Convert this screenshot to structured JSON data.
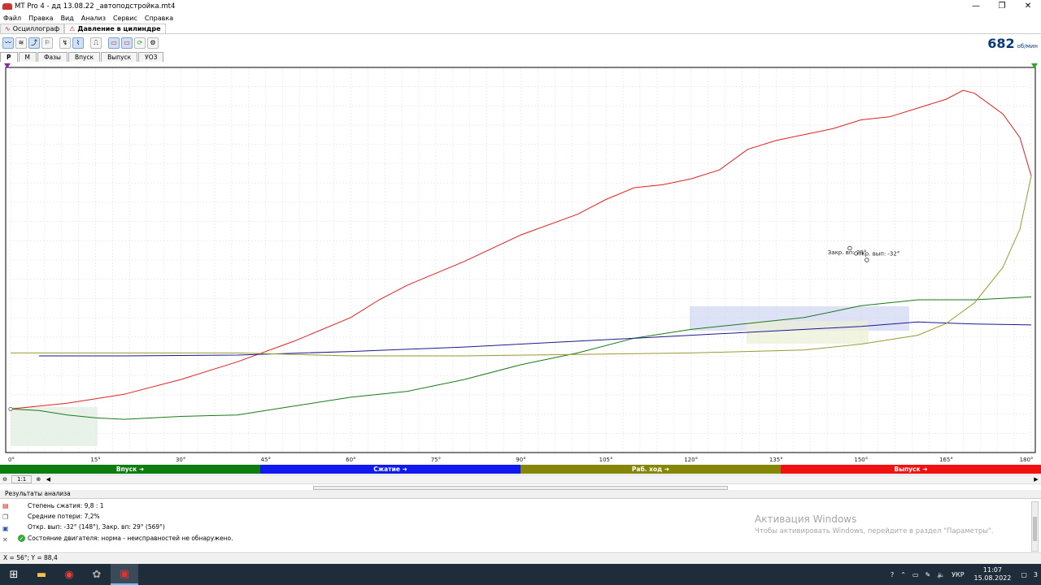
{
  "window": {
    "title": "MT Pro 4 - дд 13.08.22 _автоподстройка.mt4",
    "minimize": "—",
    "maximize": "❐",
    "close": "✕"
  },
  "menu": [
    "Файл",
    "Правка",
    "Вид",
    "Анализ",
    "Сервис",
    "Справка"
  ],
  "doc_tabs": [
    {
      "label": "Осциллограф",
      "icon": "oscilloscope-icon",
      "active": false
    },
    {
      "label": "Давление в цилиндре",
      "icon": "pressure-icon",
      "active": true
    }
  ],
  "rpm": {
    "value": "682",
    "unit": "об/мин"
  },
  "sub_tabs": [
    "P",
    "M",
    "Фазы",
    "Впуск",
    "Выпуск",
    "УОЗ"
  ],
  "chart_data": {
    "type": "line",
    "x_range": [
      0,
      180
    ],
    "x_ticks": [
      "0°",
      "15°",
      "30°",
      "45°",
      "60°",
      "75°",
      "90°",
      "105°",
      "120°",
      "135°",
      "150°",
      "165°",
      "180°"
    ],
    "grid": true,
    "colors": {
      "red": "#e02020",
      "green": "#1a7a1a",
      "blue": "#1a1a8c",
      "olive": "#9a9a30"
    },
    "annotations": [
      {
        "text": "Закр. вп: 29°",
        "x": 151,
        "y": 0.625
      },
      {
        "text": "Откр. вып: -32°",
        "x": 148,
        "y": 0.665
      }
    ],
    "series": [
      {
        "color": "red",
        "points": [
          [
            0,
            0.12
          ],
          [
            10,
            0.14
          ],
          [
            20,
            0.17
          ],
          [
            30,
            0.22
          ],
          [
            40,
            0.28
          ],
          [
            50,
            0.35
          ],
          [
            60,
            0.43
          ],
          [
            65,
            0.49
          ],
          [
            70,
            0.54
          ],
          [
            80,
            0.62
          ],
          [
            90,
            0.71
          ],
          [
            100,
            0.78
          ],
          [
            105,
            0.83
          ],
          [
            110,
            0.87
          ],
          [
            115,
            0.88
          ],
          [
            120,
            0.9
          ],
          [
            125,
            0.93
          ],
          [
            130,
            1.0
          ],
          [
            135,
            1.03
          ],
          [
            140,
            1.05
          ],
          [
            145,
            1.07
          ],
          [
            150,
            1.1
          ],
          [
            155,
            1.11
          ],
          [
            160,
            1.14
          ],
          [
            165,
            1.17
          ],
          [
            168,
            1.2
          ],
          [
            170,
            1.19
          ],
          [
            175,
            1.12
          ],
          [
            178,
            1.04
          ],
          [
            180,
            0.91
          ]
        ]
      },
      {
        "color": "green",
        "points": [
          [
            0,
            0.12
          ],
          [
            5,
            0.115
          ],
          [
            10,
            0.1
          ],
          [
            15,
            0.09
          ],
          [
            20,
            0.085
          ],
          [
            30,
            0.095
          ],
          [
            40,
            0.1
          ],
          [
            50,
            0.13
          ],
          [
            60,
            0.16
          ],
          [
            70,
            0.18
          ],
          [
            80,
            0.22
          ],
          [
            90,
            0.27
          ],
          [
            100,
            0.31
          ],
          [
            110,
            0.36
          ],
          [
            120,
            0.39
          ],
          [
            130,
            0.41
          ],
          [
            140,
            0.43
          ],
          [
            150,
            0.47
          ],
          [
            160,
            0.49
          ],
          [
            170,
            0.49
          ],
          [
            180,
            0.5
          ]
        ]
      },
      {
        "color": "blue",
        "points": [
          [
            5,
            0.3
          ],
          [
            20,
            0.3
          ],
          [
            40,
            0.303
          ],
          [
            60,
            0.315
          ],
          [
            80,
            0.33
          ],
          [
            100,
            0.35
          ],
          [
            120,
            0.37
          ],
          [
            140,
            0.39
          ],
          [
            150,
            0.4
          ],
          [
            160,
            0.415
          ],
          [
            170,
            0.408
          ],
          [
            180,
            0.405
          ]
        ]
      },
      {
        "color": "olive",
        "points": [
          [
            0,
            0.31
          ],
          [
            20,
            0.31
          ],
          [
            40,
            0.31
          ],
          [
            60,
            0.3
          ],
          [
            80,
            0.3
          ],
          [
            100,
            0.305
          ],
          [
            120,
            0.31
          ],
          [
            140,
            0.32
          ],
          [
            150,
            0.34
          ],
          [
            160,
            0.37
          ],
          [
            165,
            0.41
          ],
          [
            170,
            0.48
          ],
          [
            175,
            0.6
          ],
          [
            178,
            0.73
          ],
          [
            180,
            0.91
          ]
        ]
      }
    ]
  },
  "phases": [
    {
      "label": "Впуск ➜",
      "color": "#0e7d10"
    },
    {
      "label": "Сжатие ➜",
      "color": "#0f19f0"
    },
    {
      "label": "Раб. ход ➜",
      "color": "#868606"
    },
    {
      "label": "Выпуск ➜",
      "color": "#f21111"
    }
  ],
  "nav": {
    "zoom_label": "1:1"
  },
  "results": {
    "header": "Результаты анализа",
    "compression": "Степень сжатия: 9,8 : 1",
    "losses": "Средние потери: 7,2%",
    "valves": "Откр. вып: -32° (148°), Закр. вп: 29° (569°)",
    "state": "Состояние двигателя: норма - неисправностей не обнаружено."
  },
  "activation": {
    "title": "Активация Windows",
    "hint": "Чтобы активировать Windows, перейдите в раздел \"Параметры\"."
  },
  "status": "X = 56°; Y = 88,4",
  "taskbar": {
    "lang": "УКР",
    "time": "11:07",
    "date": "15.08.2022",
    "notifications": "3"
  }
}
